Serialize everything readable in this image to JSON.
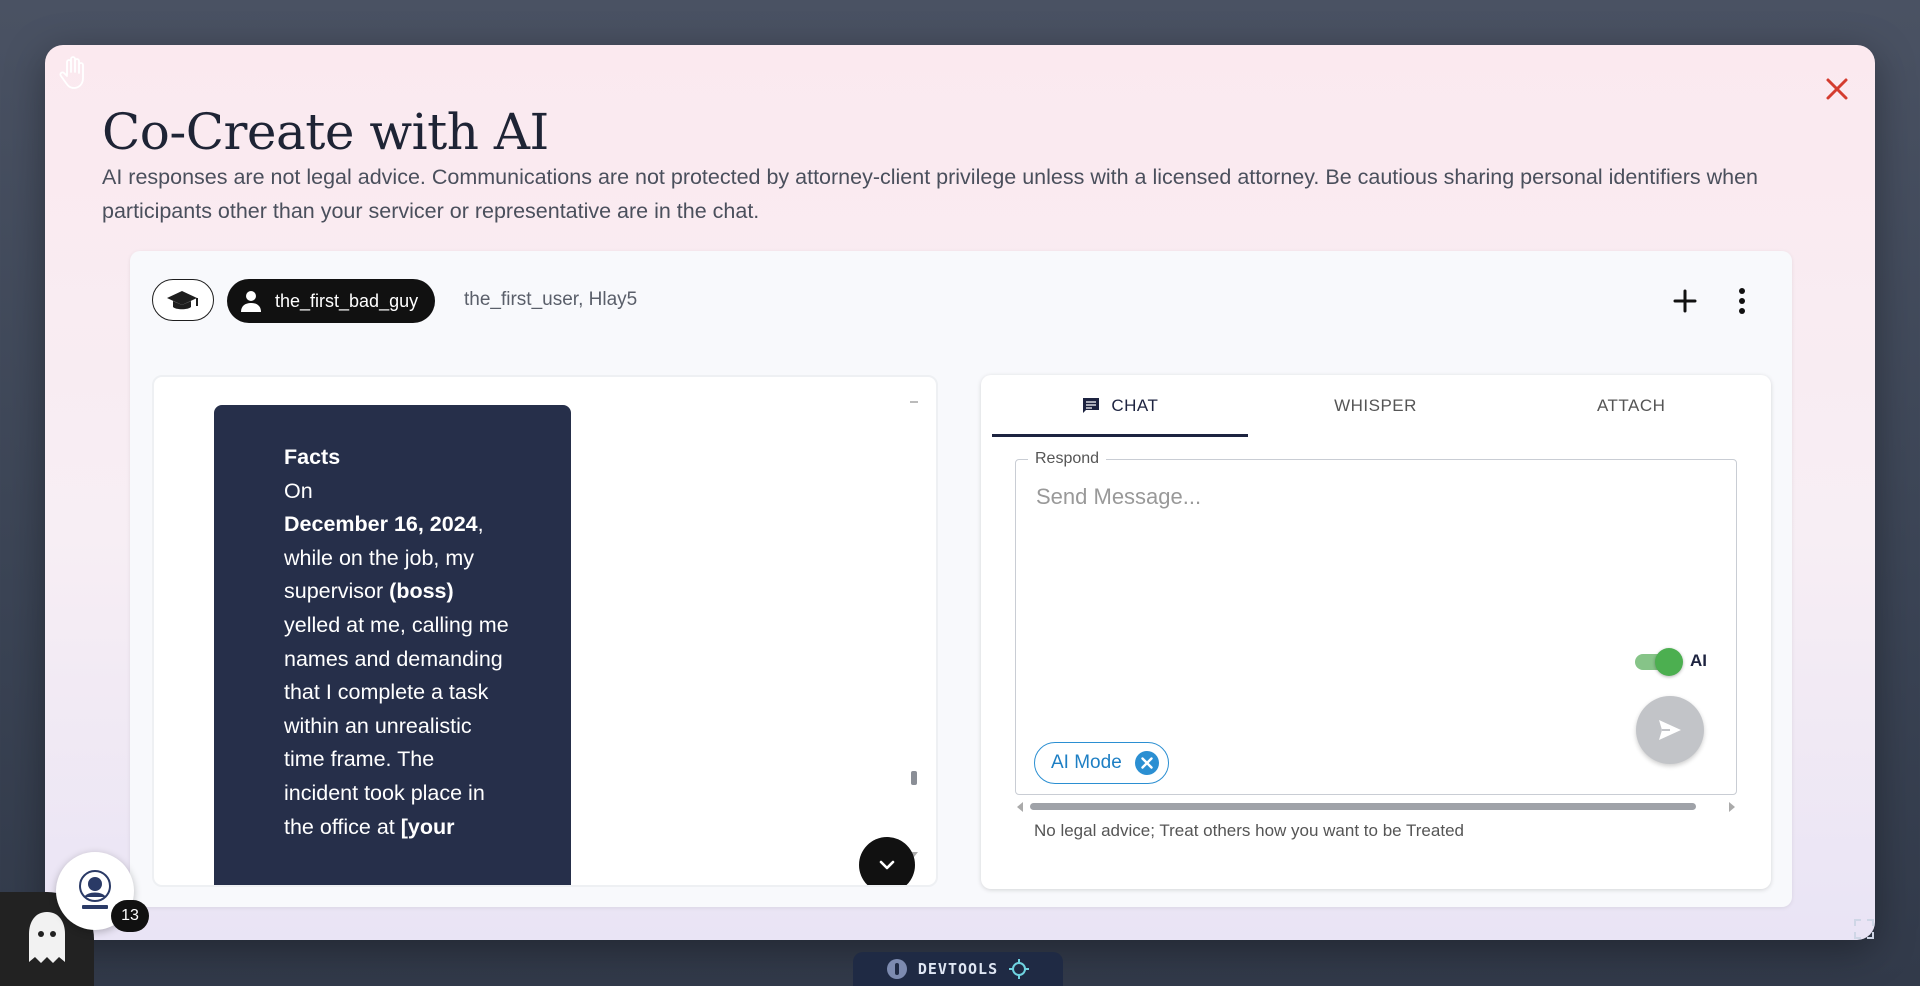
{
  "modal": {
    "title": "Co-Create with AI",
    "disclaimer": "AI responses are not legal advice. Communications are not protected by attorney-client privilege unless with a licensed attorney. Be cautious sharing personal identifiers when participants other than your servicer or representative are in the chat."
  },
  "header": {
    "active_user": "the_first_bad_guy",
    "participants": "the_first_user, Hlay5"
  },
  "message": {
    "heading": "Facts",
    "line_1": "On",
    "date": "December 16, 2024",
    "part_1": ", while on the job, my supervisor ",
    "boss": "(boss)",
    "part_2": " yelled at me, calling me names and demanding that I complete a task within an unrealistic time frame. The incident took place in the office at ",
    "placeholder": "[your"
  },
  "chat": {
    "tabs": [
      {
        "label": "CHAT",
        "icon": "chat-bubble-icon",
        "active": true
      },
      {
        "label": "WHISPER",
        "active": false
      },
      {
        "label": "ATTACH",
        "active": false
      }
    ],
    "respond_label": "Respond",
    "input_placeholder": "Send Message...",
    "ai_toggle_label": "AI",
    "ai_toggle_on": true,
    "ai_chip_label": "AI Mode",
    "footer_note": "No legal advice; Treat others how you want to be Treated"
  },
  "launcher": {
    "badge_count": "13"
  },
  "devtools": {
    "label": "DEVTOOLS"
  },
  "colors": {
    "accent": "#1d2340",
    "bubble": "#262f4a",
    "close": "#d43c2f",
    "toggle_on": "#4caf50",
    "chip": "#1e7fc4"
  }
}
